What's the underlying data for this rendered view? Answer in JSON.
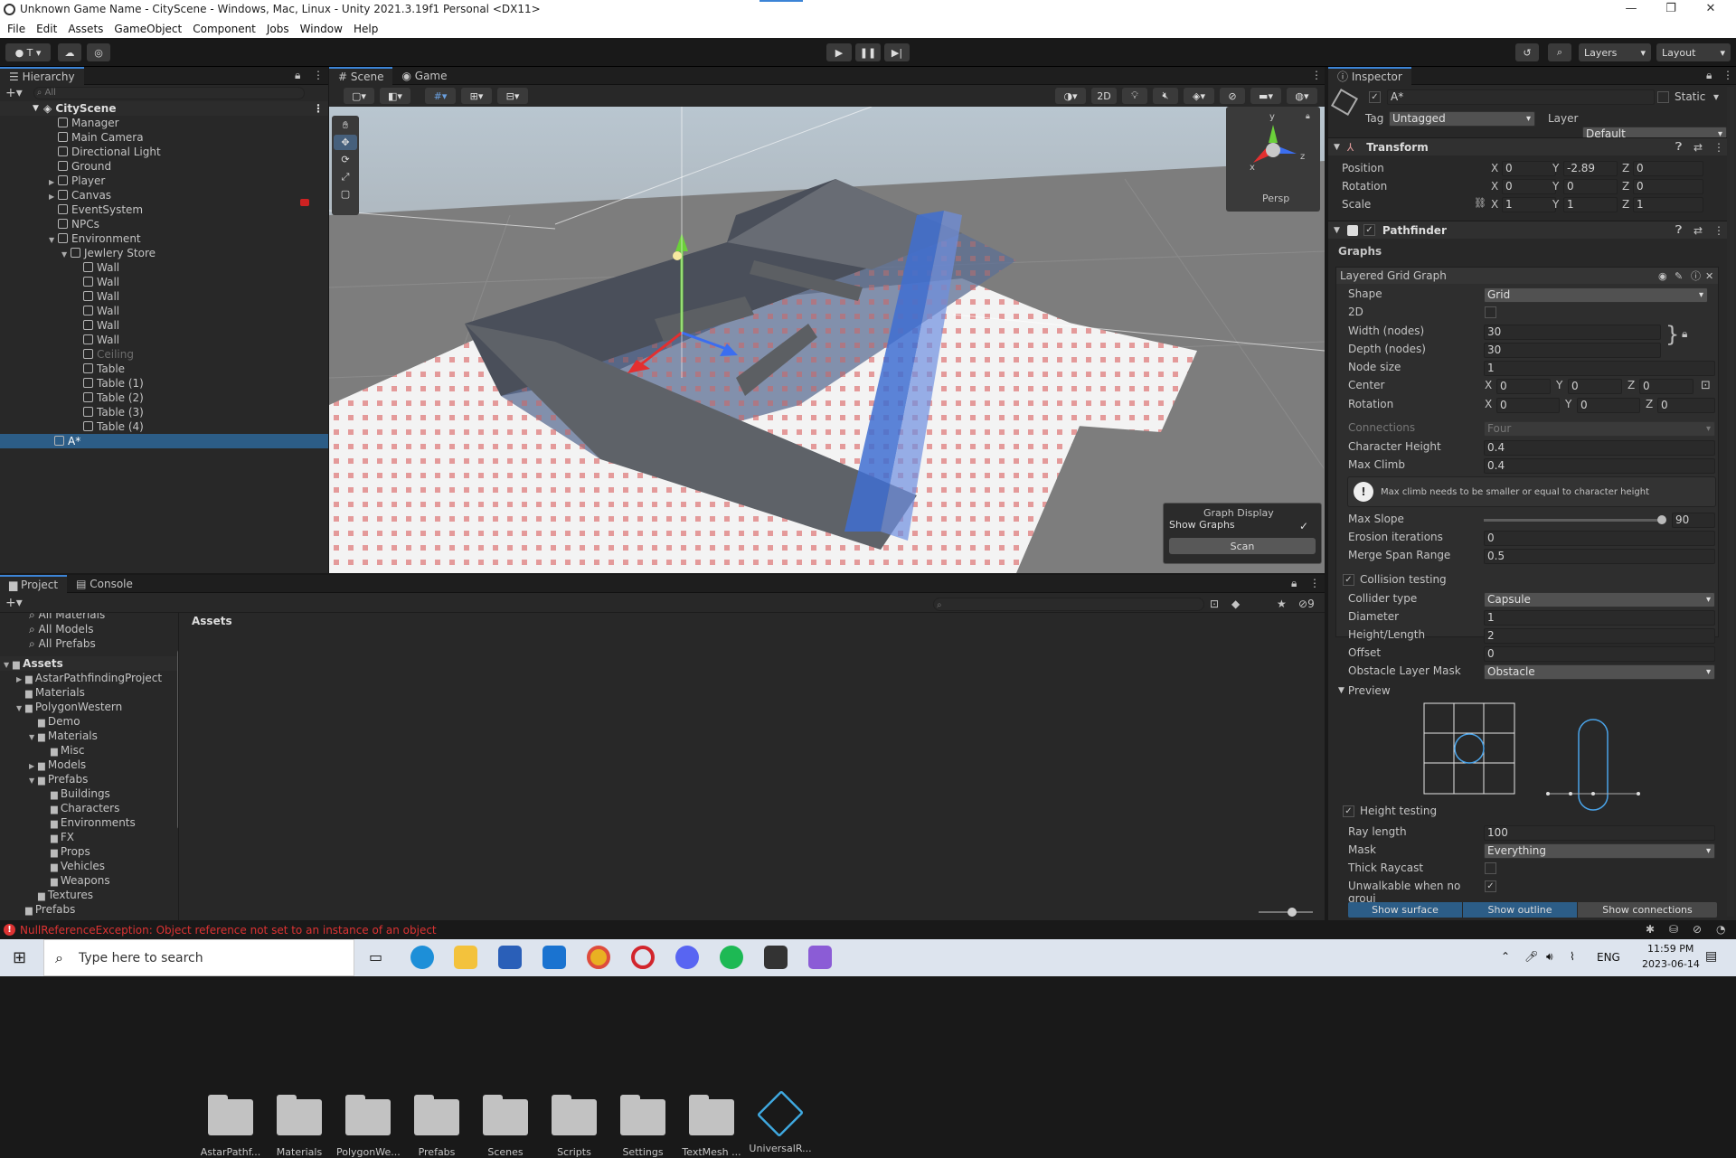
{
  "window": {
    "title": "Unknown Game Name - CityScene - Windows, Mac, Linux - Unity 2021.3.19f1 Personal <DX11>",
    "controls": [
      "—",
      "❐",
      "✕"
    ]
  },
  "menu": [
    "File",
    "Edit",
    "Assets",
    "GameObject",
    "Component",
    "Jobs",
    "Window",
    "Help"
  ],
  "toolbar": {
    "account": "T",
    "layers": "Layers",
    "layout": "Layout"
  },
  "hierarchy": {
    "tab": "Hierarchy",
    "search_placeholder": "All",
    "scene": "CityScene",
    "items": [
      {
        "label": "Manager",
        "indent": 1,
        "arrow": ""
      },
      {
        "label": "Main Camera",
        "indent": 1,
        "arrow": ""
      },
      {
        "label": "Directional Light",
        "indent": 1,
        "arrow": ""
      },
      {
        "label": "Ground",
        "indent": 1,
        "arrow": ""
      },
      {
        "label": "Player",
        "indent": 1,
        "arrow": "▶"
      },
      {
        "label": "Canvas",
        "indent": 1,
        "arrow": "▶"
      },
      {
        "label": "EventSystem",
        "indent": 1,
        "arrow": ""
      },
      {
        "label": "NPCs",
        "indent": 1,
        "arrow": ""
      },
      {
        "label": "Environment",
        "indent": 1,
        "arrow": "▼"
      },
      {
        "label": "Jewlery Store",
        "indent": 2,
        "arrow": "▼"
      },
      {
        "label": "Wall",
        "indent": 3,
        "arrow": ""
      },
      {
        "label": "Wall",
        "indent": 3,
        "arrow": ""
      },
      {
        "label": "Wall",
        "indent": 3,
        "arrow": ""
      },
      {
        "label": "Wall",
        "indent": 3,
        "arrow": ""
      },
      {
        "label": "Wall",
        "indent": 3,
        "arrow": ""
      },
      {
        "label": "Wall",
        "indent": 3,
        "arrow": ""
      },
      {
        "label": "Ceiling",
        "indent": 3,
        "arrow": "",
        "disabled": true
      },
      {
        "label": "Table",
        "indent": 3,
        "arrow": ""
      },
      {
        "label": "Table (1)",
        "indent": 3,
        "arrow": ""
      },
      {
        "label": "Table (2)",
        "indent": 3,
        "arrow": ""
      },
      {
        "label": "Table (3)",
        "indent": 3,
        "arrow": ""
      },
      {
        "label": "Table (4)",
        "indent": 3,
        "arrow": ""
      }
    ],
    "selected": "A*"
  },
  "scene_view": {
    "tabs": [
      "Scene",
      "Game"
    ],
    "mode_2d": "2D",
    "persp": "Persp",
    "gizmo_axes": [
      "y",
      "x",
      "z"
    ],
    "graph_display": {
      "title": "Graph Display",
      "show_graphs": "Show Graphs",
      "scan": "Scan"
    }
  },
  "project": {
    "tabs": [
      "Project",
      "Console"
    ],
    "favorites": [
      "All Materials",
      "All Models",
      "All Prefabs"
    ],
    "tree": [
      {
        "label": "Assets",
        "indent": 0,
        "arrow": "▼",
        "bold": true
      },
      {
        "label": "AstarPathfindingProject",
        "indent": 1,
        "arrow": "▶"
      },
      {
        "label": "Materials",
        "indent": 1,
        "arrow": ""
      },
      {
        "label": "PolygonWestern",
        "indent": 1,
        "arrow": "▼"
      },
      {
        "label": "Demo",
        "indent": 2,
        "arrow": ""
      },
      {
        "label": "Materials",
        "indent": 2,
        "arrow": "▼"
      },
      {
        "label": "Misc",
        "indent": 3,
        "arrow": ""
      },
      {
        "label": "Models",
        "indent": 2,
        "arrow": "▶"
      },
      {
        "label": "Prefabs",
        "indent": 2,
        "arrow": "▼"
      },
      {
        "label": "Buildings",
        "indent": 3,
        "arrow": ""
      },
      {
        "label": "Characters",
        "indent": 3,
        "arrow": ""
      },
      {
        "label": "Environments",
        "indent": 3,
        "arrow": ""
      },
      {
        "label": "FX",
        "indent": 3,
        "arrow": ""
      },
      {
        "label": "Props",
        "indent": 3,
        "arrow": ""
      },
      {
        "label": "Vehicles",
        "indent": 3,
        "arrow": ""
      },
      {
        "label": "Weapons",
        "indent": 3,
        "arrow": ""
      },
      {
        "label": "Textures",
        "indent": 2,
        "arrow": ""
      },
      {
        "label": "Prefabs",
        "indent": 1,
        "arrow": ""
      }
    ],
    "breadcrumb": "Assets",
    "hidden_count": "9",
    "assets": [
      "AstarPathf...",
      "Materials",
      "PolygonWe...",
      "Prefabs",
      "Scenes",
      "Scripts",
      "Settings",
      "TextMesh ...",
      "UniversalR..."
    ]
  },
  "status": {
    "error": "NullReferenceException: Object reference not set to an instance of an object"
  },
  "inspector": {
    "tab": "Inspector",
    "object_name": "A*",
    "static_label": "Static",
    "tag_label": "Tag",
    "tag_value": "Untagged",
    "layer_label": "Layer",
    "layer_value": "Default",
    "transform": {
      "title": "Transform",
      "rows": [
        {
          "label": "Position",
          "x": "0",
          "y": "-2.89",
          "z": "0"
        },
        {
          "label": "Rotation",
          "x": "0",
          "y": "0",
          "z": "0"
        },
        {
          "label": "Scale",
          "x": "1",
          "y": "1",
          "z": "1"
        }
      ]
    },
    "pathfinder": {
      "title": "Pathfinder",
      "graphs": "Graphs",
      "graph_name": "Layered Grid Graph",
      "shape_label": "Shape",
      "shape_value": "Grid",
      "twod_label": "2D",
      "width_label": "Width (nodes)",
      "width_value": "30",
      "depth_label": "Depth (nodes)",
      "depth_value": "30",
      "node_size_label": "Node size",
      "node_size_value": "1",
      "center_label": "Center",
      "center": {
        "x": "0",
        "y": "0",
        "z": "0"
      },
      "rotation_label": "Rotation",
      "rotation": {
        "x": "0",
        "y": "0",
        "z": "0"
      },
      "connections_label": "Connections",
      "connections_value": "Four",
      "char_height_label": "Character Height",
      "char_height_value": "0.4",
      "max_climb_label": "Max Climb",
      "max_climb_value": "0.4",
      "warning": "Max climb needs to be smaller or equal to character height",
      "max_slope_label": "Max Slope",
      "max_slope_value": "90",
      "erosion_label": "Erosion iterations",
      "erosion_value": "0",
      "merge_label": "Merge Span Range",
      "merge_value": "0.5",
      "collision_title": "Collision testing",
      "collider_type_label": "Collider type",
      "collider_type_value": "Capsule",
      "diameter_label": "Diameter",
      "diameter_value": "1",
      "height_length_label": "Height/Length",
      "height_length_value": "2",
      "offset_label": "Offset",
      "offset_value": "0",
      "obstacle_label": "Obstacle Layer Mask",
      "obstacle_value": "Obstacle",
      "preview_title": "Preview",
      "height_title": "Height testing",
      "ray_length_label": "Ray length",
      "ray_length_value": "100",
      "mask_label": "Mask",
      "mask_value": "Everything",
      "thick_raycast_label": "Thick Raycast",
      "unwalkable_label": "Unwalkable when no groui",
      "buttons": [
        "Show surface",
        "Show outline",
        "Show connections"
      ]
    }
  },
  "taskbar": {
    "search_placeholder": "Type here to search",
    "lang": "ENG",
    "time": "11:59 PM",
    "date": "2023-06-14"
  }
}
